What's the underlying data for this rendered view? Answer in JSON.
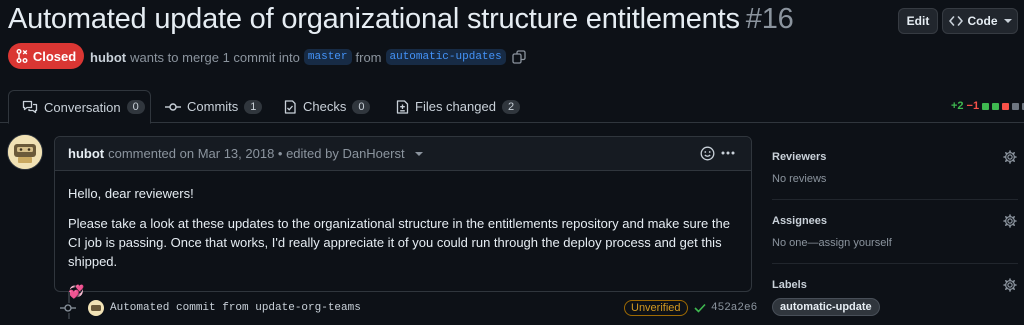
{
  "pr": {
    "title": "Automated update of organizational structure entitlements",
    "number": "#16",
    "state": "Closed",
    "author": "hubot",
    "merge_text": "wants to merge 1 commit into",
    "base_branch": "master",
    "from_text": "from",
    "head_branch": "automatic-updates"
  },
  "header_buttons": {
    "edit": "Edit",
    "code": "Code"
  },
  "tabs": [
    {
      "label": "Conversation",
      "count": "0"
    },
    {
      "label": "Commits",
      "count": "1"
    },
    {
      "label": "Checks",
      "count": "0"
    },
    {
      "label": "Files changed",
      "count": "2"
    }
  ],
  "diffstat": {
    "additions": "+2",
    "deletions": "−1"
  },
  "comment": {
    "author": "hubot",
    "meta": "commented on Mar 13, 2018 • edited by DanHoerst",
    "greeting": "Hello, dear reviewers!",
    "body": "Please take a look at these updates to the organizational structure in the entitlements repository and make sure the CI job is passing. Once that works, I'd really appreciate it of you could run through the deploy process and get this shipped.",
    "emoji": "💞"
  },
  "commit": {
    "message": "Automated commit from update-org-teams",
    "badge": "Unverified",
    "sha": "452a2e6"
  },
  "sidebar": {
    "reviewers": {
      "title": "Reviewers",
      "value": "No reviews"
    },
    "assignees": {
      "title": "Assignees",
      "value": "No one—assign yourself"
    },
    "labels": {
      "title": "Labels",
      "items": [
        "automatic-update"
      ]
    }
  },
  "colors": {
    "closed": "#da3633",
    "addition": "#3fb950",
    "deletion": "#f85149",
    "branch_bg": "#172b45",
    "branch_fg": "#4493f8"
  }
}
